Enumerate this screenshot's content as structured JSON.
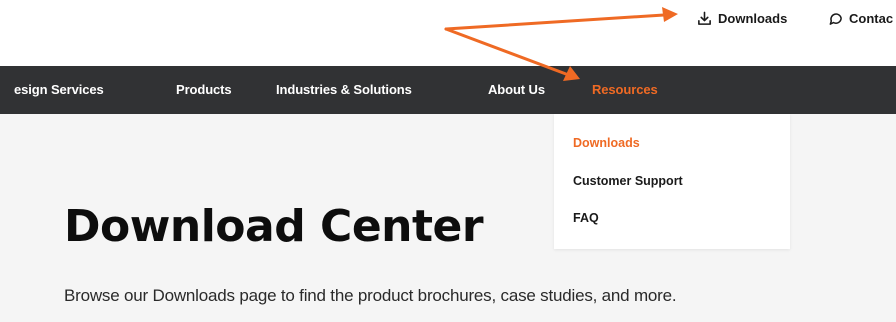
{
  "colors": {
    "accent": "#ef6a24",
    "nav_bg": "#313234",
    "page_bg": "#f5f5f5",
    "annotation": "#ef6a24"
  },
  "utility_nav": {
    "downloads": {
      "label": "Downloads",
      "icon": "download-icon"
    },
    "contact": {
      "label": "Contac",
      "icon": "contact-icon"
    }
  },
  "main_nav": {
    "items": [
      {
        "label": "esign Services"
      },
      {
        "label": "Products"
      },
      {
        "label": "Industries & Solutions"
      },
      {
        "label": "About Us"
      },
      {
        "label": "Resources",
        "active": true
      }
    ]
  },
  "resources_menu": {
    "items": [
      {
        "label": "Downloads",
        "active": true
      },
      {
        "label": "Customer Support"
      },
      {
        "label": "FAQ"
      }
    ]
  },
  "page": {
    "title": "Download Center",
    "description": "Browse our Downloads page to find the product brochures, case studies, and more."
  }
}
